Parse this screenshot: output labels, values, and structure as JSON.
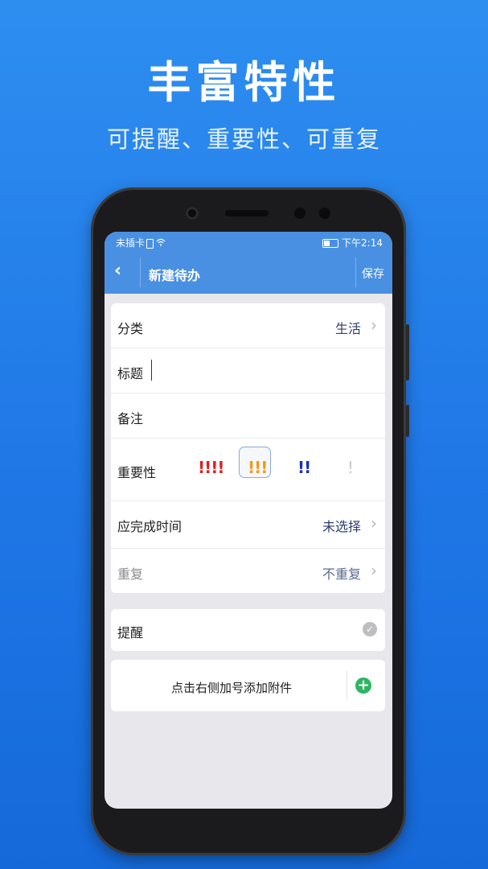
{
  "promo": {
    "title": "丰富特性",
    "subtitle": "可提醒、重要性、可重复"
  },
  "statusbar": {
    "carrier": "未插卡",
    "time": "下午2:14"
  },
  "toolbar": {
    "back_icon": "‹",
    "title": "新建待办",
    "save_label": "保存"
  },
  "form": {
    "category_label": "分类",
    "category_value": "生活",
    "title_label": "标题",
    "note_label": "备注",
    "importance_label": "重要性",
    "importance_options": [
      {
        "mark": "!!!!",
        "color": "#e02020"
      },
      {
        "mark": "!!!",
        "color": "#f09a1a"
      },
      {
        "mark": "!!",
        "color": "#1c2fb8"
      },
      {
        "mark": "!",
        "color": "#c9c9cc"
      }
    ],
    "importance_selected_index": 1,
    "due_label": "应完成时间",
    "due_value": "未选择",
    "repeat_label": "重复",
    "repeat_value": "不重复",
    "chevron": "›"
  },
  "reminder": {
    "label": "提醒",
    "check": "✓"
  },
  "attachment": {
    "text": "点击右侧加号添加附件",
    "add_icon": "+"
  },
  "colors": {
    "accent": "#4a90e2",
    "add_green": "#2db562"
  }
}
